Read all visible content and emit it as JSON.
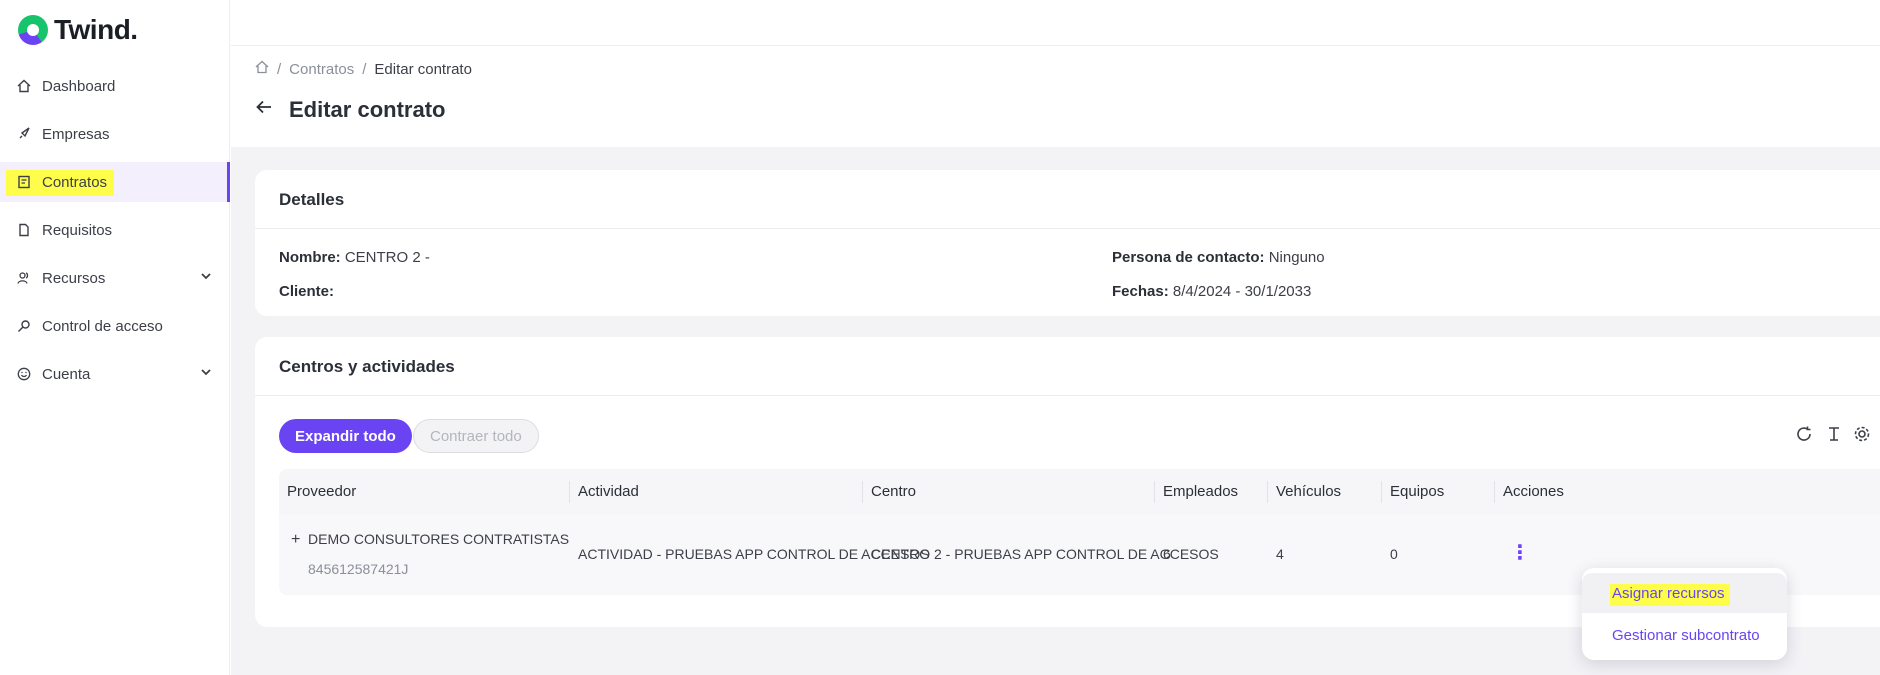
{
  "brand": {
    "name": "Twind."
  },
  "sidebar": {
    "items": [
      {
        "label": "Dashboard",
        "icon": "home-icon"
      },
      {
        "label": "Empresas",
        "icon": "rocket-icon"
      },
      {
        "label": "Contratos",
        "icon": "contract-icon",
        "active": true
      },
      {
        "label": "Requisitos",
        "icon": "document-icon"
      },
      {
        "label": "Recursos",
        "icon": "users-icon",
        "expandable": true
      },
      {
        "label": "Control de acceso",
        "icon": "key-icon"
      },
      {
        "label": "Cuenta",
        "icon": "smile-icon",
        "expandable": true
      }
    ]
  },
  "breadcrumb": {
    "items": [
      "Contratos",
      "Editar contrato"
    ]
  },
  "page": {
    "title": "Editar contrato"
  },
  "details": {
    "title": "Detalles",
    "nombre_label": "Nombre:",
    "nombre_value": "CENTRO 2 -",
    "cliente_label": "Cliente:",
    "cliente_value": "",
    "persona_label": "Persona de contacto:",
    "persona_value": "Ninguno",
    "fechas_label": "Fechas:",
    "fechas_value": "8/4/2024 - 30/1/2033"
  },
  "centros": {
    "title": "Centros y actividades",
    "expand_label": "Expandir todo",
    "collapse_label": "Contraer todo",
    "columns": [
      "Proveedor",
      "Actividad",
      "Centro",
      "Empleados",
      "Vehículos",
      "Equipos",
      "Acciones"
    ],
    "rows": [
      {
        "expander": "+",
        "proveedor": "DEMO CONSULTORES CONTRATISTAS",
        "proveedor_id": "845612587421J",
        "actividad": "ACTIVIDAD - PRUEBAS APP CONTROL DE ACCESOS",
        "centro": "CENTRO 2 - PRUEBAS APP CONTROL DE ACCESOS",
        "empleados": "6",
        "vehiculos": "4",
        "equipos": "0",
        "acciones": "⋮"
      }
    ]
  },
  "actions_menu": {
    "items": [
      "Asignar recursos",
      "Gestionar subcontrato"
    ]
  },
  "colors": {
    "accent": "#6a44f2",
    "highlight": "#ffff2b",
    "brand_green": "#18c46b"
  }
}
